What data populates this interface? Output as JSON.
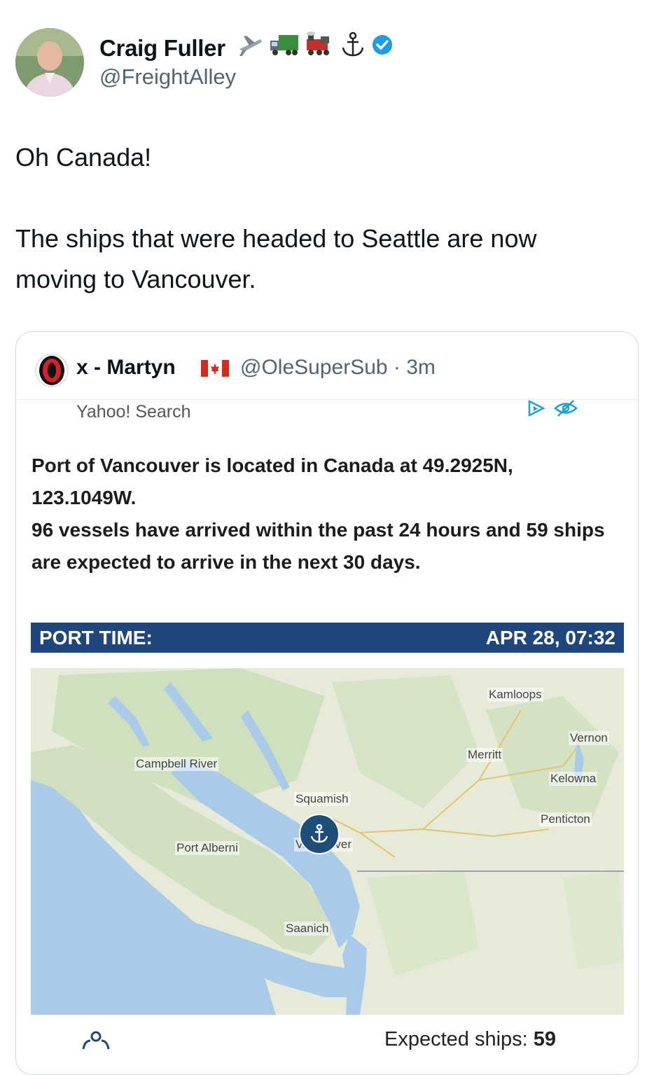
{
  "author": {
    "name": "Craig Fuller",
    "handle": "@FreightAlley",
    "emoji": [
      "airplane-icon",
      "truck-icon",
      "train-icon",
      "anchor-icon"
    ],
    "verified": true
  },
  "tweet": {
    "text": "Oh Canada!\n\nThe ships that were headed to Seattle are now moving to Vancouver."
  },
  "quote": {
    "name": "x - Martyn",
    "flag": "canada-flag-icon",
    "handle_time": "@OleSuperSub · 3m",
    "source": "Yahoo! Search",
    "description_1": "Port of Vancouver is located in Canada at 49.2925N, 123.1049W.",
    "description_2": "96 vessels have arrived within the past 24 hours and 59 ships are expected to arrive in the next 30 days.",
    "port_time_label": "PORT TIME:",
    "port_time_value": "APR 28, 07:32",
    "expected_label": "Expected ships:",
    "expected_value": "59"
  },
  "map": {
    "labels": {
      "kamloops": "Kamloops",
      "vernon": "Vernon",
      "merritt": "Merritt",
      "kelowna": "Kelowna",
      "penticton": "Penticton",
      "campbell_river": "Campbell River",
      "squamish": "Squamish",
      "port_alberni": "Port Alberni",
      "vancouver": "Vancouver",
      "saanich": "Saanich"
    },
    "colors": {
      "water": "#a9cbe9",
      "land": "#e8ead9",
      "forest": "#cfe0bf",
      "pin": "#1e4d78"
    }
  }
}
